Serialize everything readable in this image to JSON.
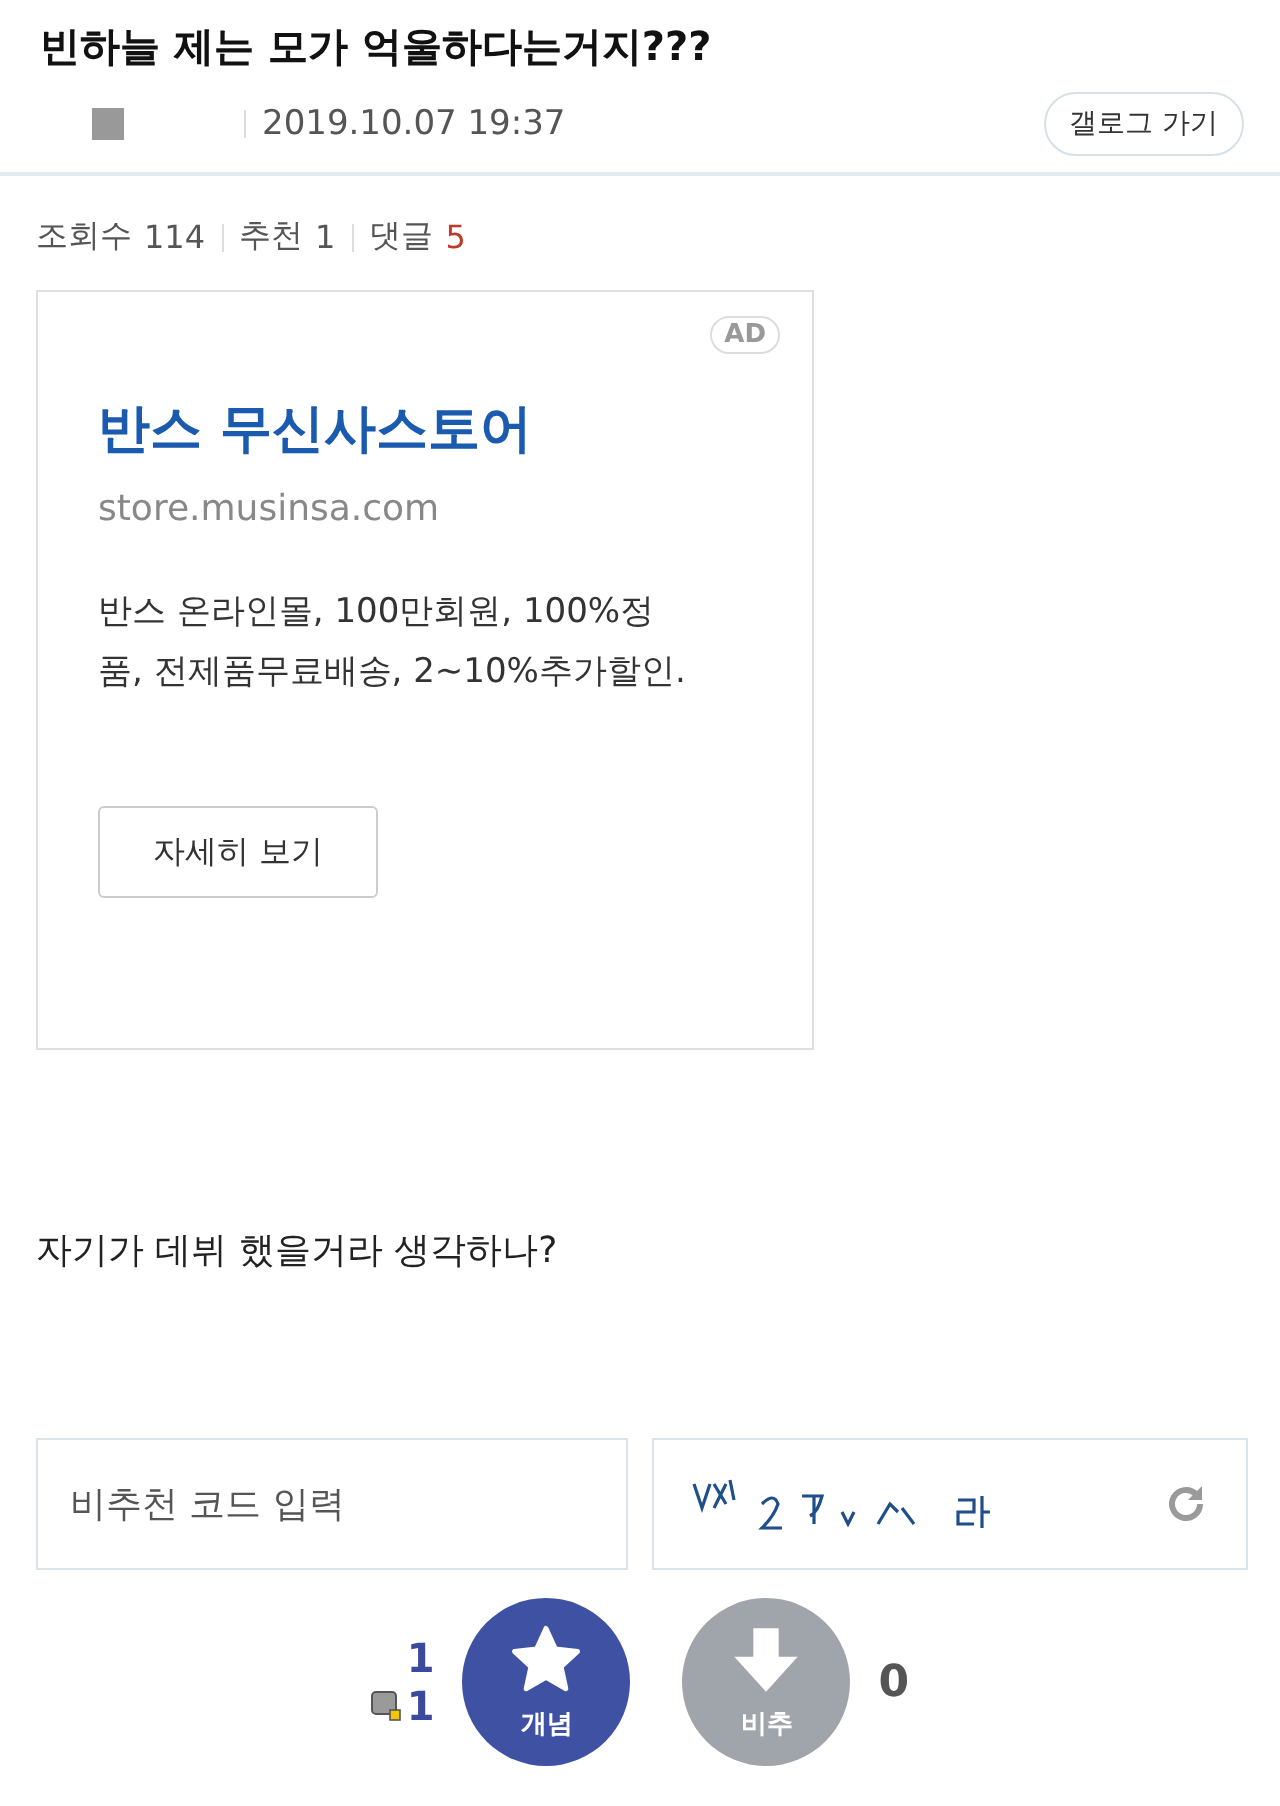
{
  "post": {
    "title": "빈하늘 제는 모가 억울하다는거지???",
    "date": "2019.10.07 19:37",
    "gallog_button": "갤로그 가기"
  },
  "stats": [
    {
      "label": "조회수",
      "value": "114",
      "highlight": false
    },
    {
      "label": "추천",
      "value": "1",
      "highlight": false
    },
    {
      "label": "댓글",
      "value": "5",
      "highlight": true
    }
  ],
  "ad": {
    "badge": "AD",
    "title": "반스 무신사스토어",
    "url": "store.musinsa.com",
    "description_lines": [
      "반스 온라인몰, 100만회원, 100%정",
      "품, 전제품무료배송, 2~10%추가할인."
    ],
    "button": "자세히 보기"
  },
  "body": "자기가 데뷔 했을거라 생각하나?",
  "captcha": {
    "placeholder": "비추천 코드 입력",
    "kind": "picture"
  },
  "votes": {
    "up_count": "1",
    "fixed_count": "1",
    "up_label": "개념",
    "down_label": "비추",
    "down_count": "0"
  }
}
